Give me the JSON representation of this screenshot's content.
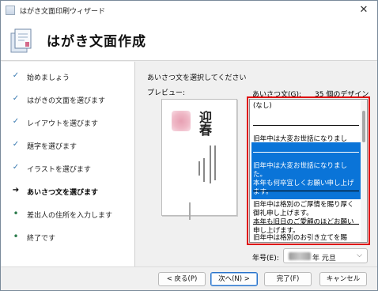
{
  "window": {
    "title": "はがき文面印刷ウィザード",
    "close_glyph": "✕"
  },
  "header": {
    "title": "はがき文面作成"
  },
  "steps": [
    {
      "label": "始めましょう",
      "state": "done"
    },
    {
      "label": "はがきの文面を選びます",
      "state": "done"
    },
    {
      "label": "レイアウトを選びます",
      "state": "done"
    },
    {
      "label": "題字を選びます",
      "state": "done"
    },
    {
      "label": "イラストを選びます",
      "state": "done"
    },
    {
      "label": "あいさつ文を選びます",
      "state": "current"
    },
    {
      "label": "差出人の住所を入力します",
      "state": "pending"
    },
    {
      "label": "終了です",
      "state": "pending"
    }
  ],
  "main": {
    "instruction": "あいさつ文を選択してください",
    "preview_label": "プレビュー:",
    "preview_greeting": "迎春",
    "design_label": "あいさつ文(G):",
    "design_count": "35 個のデザイン",
    "options": [
      {
        "text": "(なし)",
        "selected": false
      },
      {
        "text": "旧年中は大変お世話になりました。\n今年もよろしくお願いします。",
        "selected": false
      },
      {
        "text": "旧年中は大変お世話になりました。\n本年も何卒宜しくお願い申し上げます。",
        "selected": true
      },
      {
        "text": "旧年中は格別のご厚情を賜り厚く御礼申し上げます。\n本年も旧日のご愛顧のほどお願い申し上げます。",
        "selected": false
      },
      {
        "text": "旧年中は格別のお引き立てを賜り、厚く御礼申し上げます。\n本年も旧日のご指導のほど、お",
        "selected": false
      }
    ],
    "year_label": "年号(E):",
    "year_value": "年 元旦"
  },
  "footer": {
    "back": "< 戻る(P)",
    "next": "次へ(N) >",
    "finish": "完了(F)",
    "cancel": "キャンセル"
  },
  "colors": {
    "selection": "#0a74d8",
    "highlight_border": "#e01010"
  }
}
